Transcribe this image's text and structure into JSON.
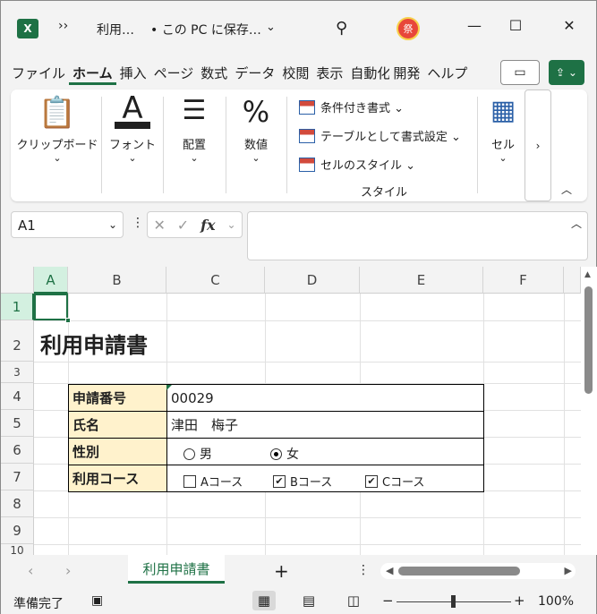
{
  "titlebar": {
    "logo": "X",
    "overflow_glyph": "››",
    "doc_name": "利用…",
    "save_location": "• この PC に保存…",
    "caret": "⌄",
    "search_glyph": "⚲",
    "avatar_text": "祭",
    "minimize": "—",
    "maximize": "☐",
    "close": "✕"
  },
  "ribbon_tabs": [
    "ファイル",
    "ホーム",
    "挿入",
    "ページ",
    "数式",
    "データ",
    "校閲",
    "表示",
    "自動化",
    "開発",
    "ヘルプ"
  ],
  "ribbon_active_tab": "ホーム",
  "comment_glyph": "▭",
  "share_glyph": "⇪ ⌄",
  "ribbon": {
    "clipboard": {
      "icon": "📋",
      "label": "クリップボード",
      "caret": "⌄"
    },
    "font": {
      "icon": "A",
      "label": "フォント",
      "caret": "⌄"
    },
    "alignment": {
      "icon": "☰",
      "label": "配置",
      "caret": "⌄"
    },
    "number": {
      "icon": "%",
      "label": "数値",
      "caret": "⌄"
    },
    "styles": {
      "items": [
        "条件付き書式 ⌄",
        "テーブルとして書式設定 ⌄",
        "セルのスタイル ⌄"
      ],
      "label": "スタイル"
    },
    "cells": {
      "icon": "▦",
      "label": "セル",
      "caret": "⌄"
    },
    "more": "›",
    "collapse": "︿"
  },
  "formula_bar": {
    "name_box": "A1",
    "name_caret": "⌄",
    "dots": "⋮",
    "cancel": "✕",
    "enter": "✓",
    "fx": "fx",
    "fx_caret": "⌄",
    "formula": "",
    "expand": "︿"
  },
  "columns": [
    "A",
    "B",
    "C",
    "D",
    "E",
    "F"
  ],
  "rows": [
    "1",
    "2",
    "3",
    "4",
    "5",
    "6",
    "7",
    "8",
    "9",
    "10"
  ],
  "sheet": {
    "title": "利用申請書",
    "form": [
      {
        "label": "申請番号",
        "value": "00029"
      },
      {
        "label": "氏名",
        "value": "津田　梅子"
      },
      {
        "label": "性別",
        "value": ""
      },
      {
        "label": "利用コース",
        "value": ""
      }
    ],
    "gender_options": [
      {
        "label": "男",
        "selected": false
      },
      {
        "label": "女",
        "selected": true
      }
    ],
    "course_options": [
      {
        "label": "Aコース",
        "checked": false
      },
      {
        "label": "Bコース",
        "checked": true
      },
      {
        "label": "Cコース",
        "checked": true
      }
    ],
    "check_glyph": "✔"
  },
  "sheet_tabs": {
    "prev": "‹",
    "next": "›",
    "active": "利用申請書",
    "add": "+",
    "dots": "⋮",
    "scroll_left": "◀",
    "scroll_right": "▶"
  },
  "statusbar": {
    "status": "準備完了",
    "access_icon": "▣",
    "view_normal": "▦",
    "view_page_layout": "▤",
    "view_page_break": "◫",
    "zoom_minus": "−",
    "zoom_plus": "+",
    "zoom": "100%"
  },
  "colors": {
    "accent": "#1e7145",
    "label_fill": "#fff2cc",
    "grid": "#e1e1e1"
  }
}
